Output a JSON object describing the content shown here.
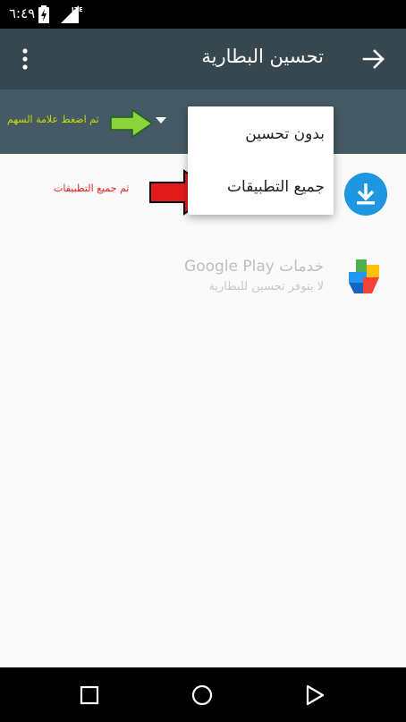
{
  "status_bar": {
    "time": "٦:٤٩",
    "network": "LTE"
  },
  "toolbar": {
    "title": "تحسين البطارية"
  },
  "filter_bar": {
    "hint_press_arrow": "ثم اضغط علامة السهم"
  },
  "list": {
    "hint_all_apps": "ثم جميع التطبيقات",
    "apps": [
      {
        "title": "خدمات Google Play",
        "subtitle": "لا يتوفر تحسين للبطارية"
      }
    ]
  },
  "menu": {
    "items": [
      {
        "label": "بدون تحسين"
      },
      {
        "label": "جميع التطبيقات"
      }
    ]
  },
  "colors": {
    "toolbar": "#37474f",
    "filter_bar": "#455a64",
    "accent_blue": "#1e96e0",
    "hint_green": "#c6e000",
    "hint_red": "#e52222"
  }
}
